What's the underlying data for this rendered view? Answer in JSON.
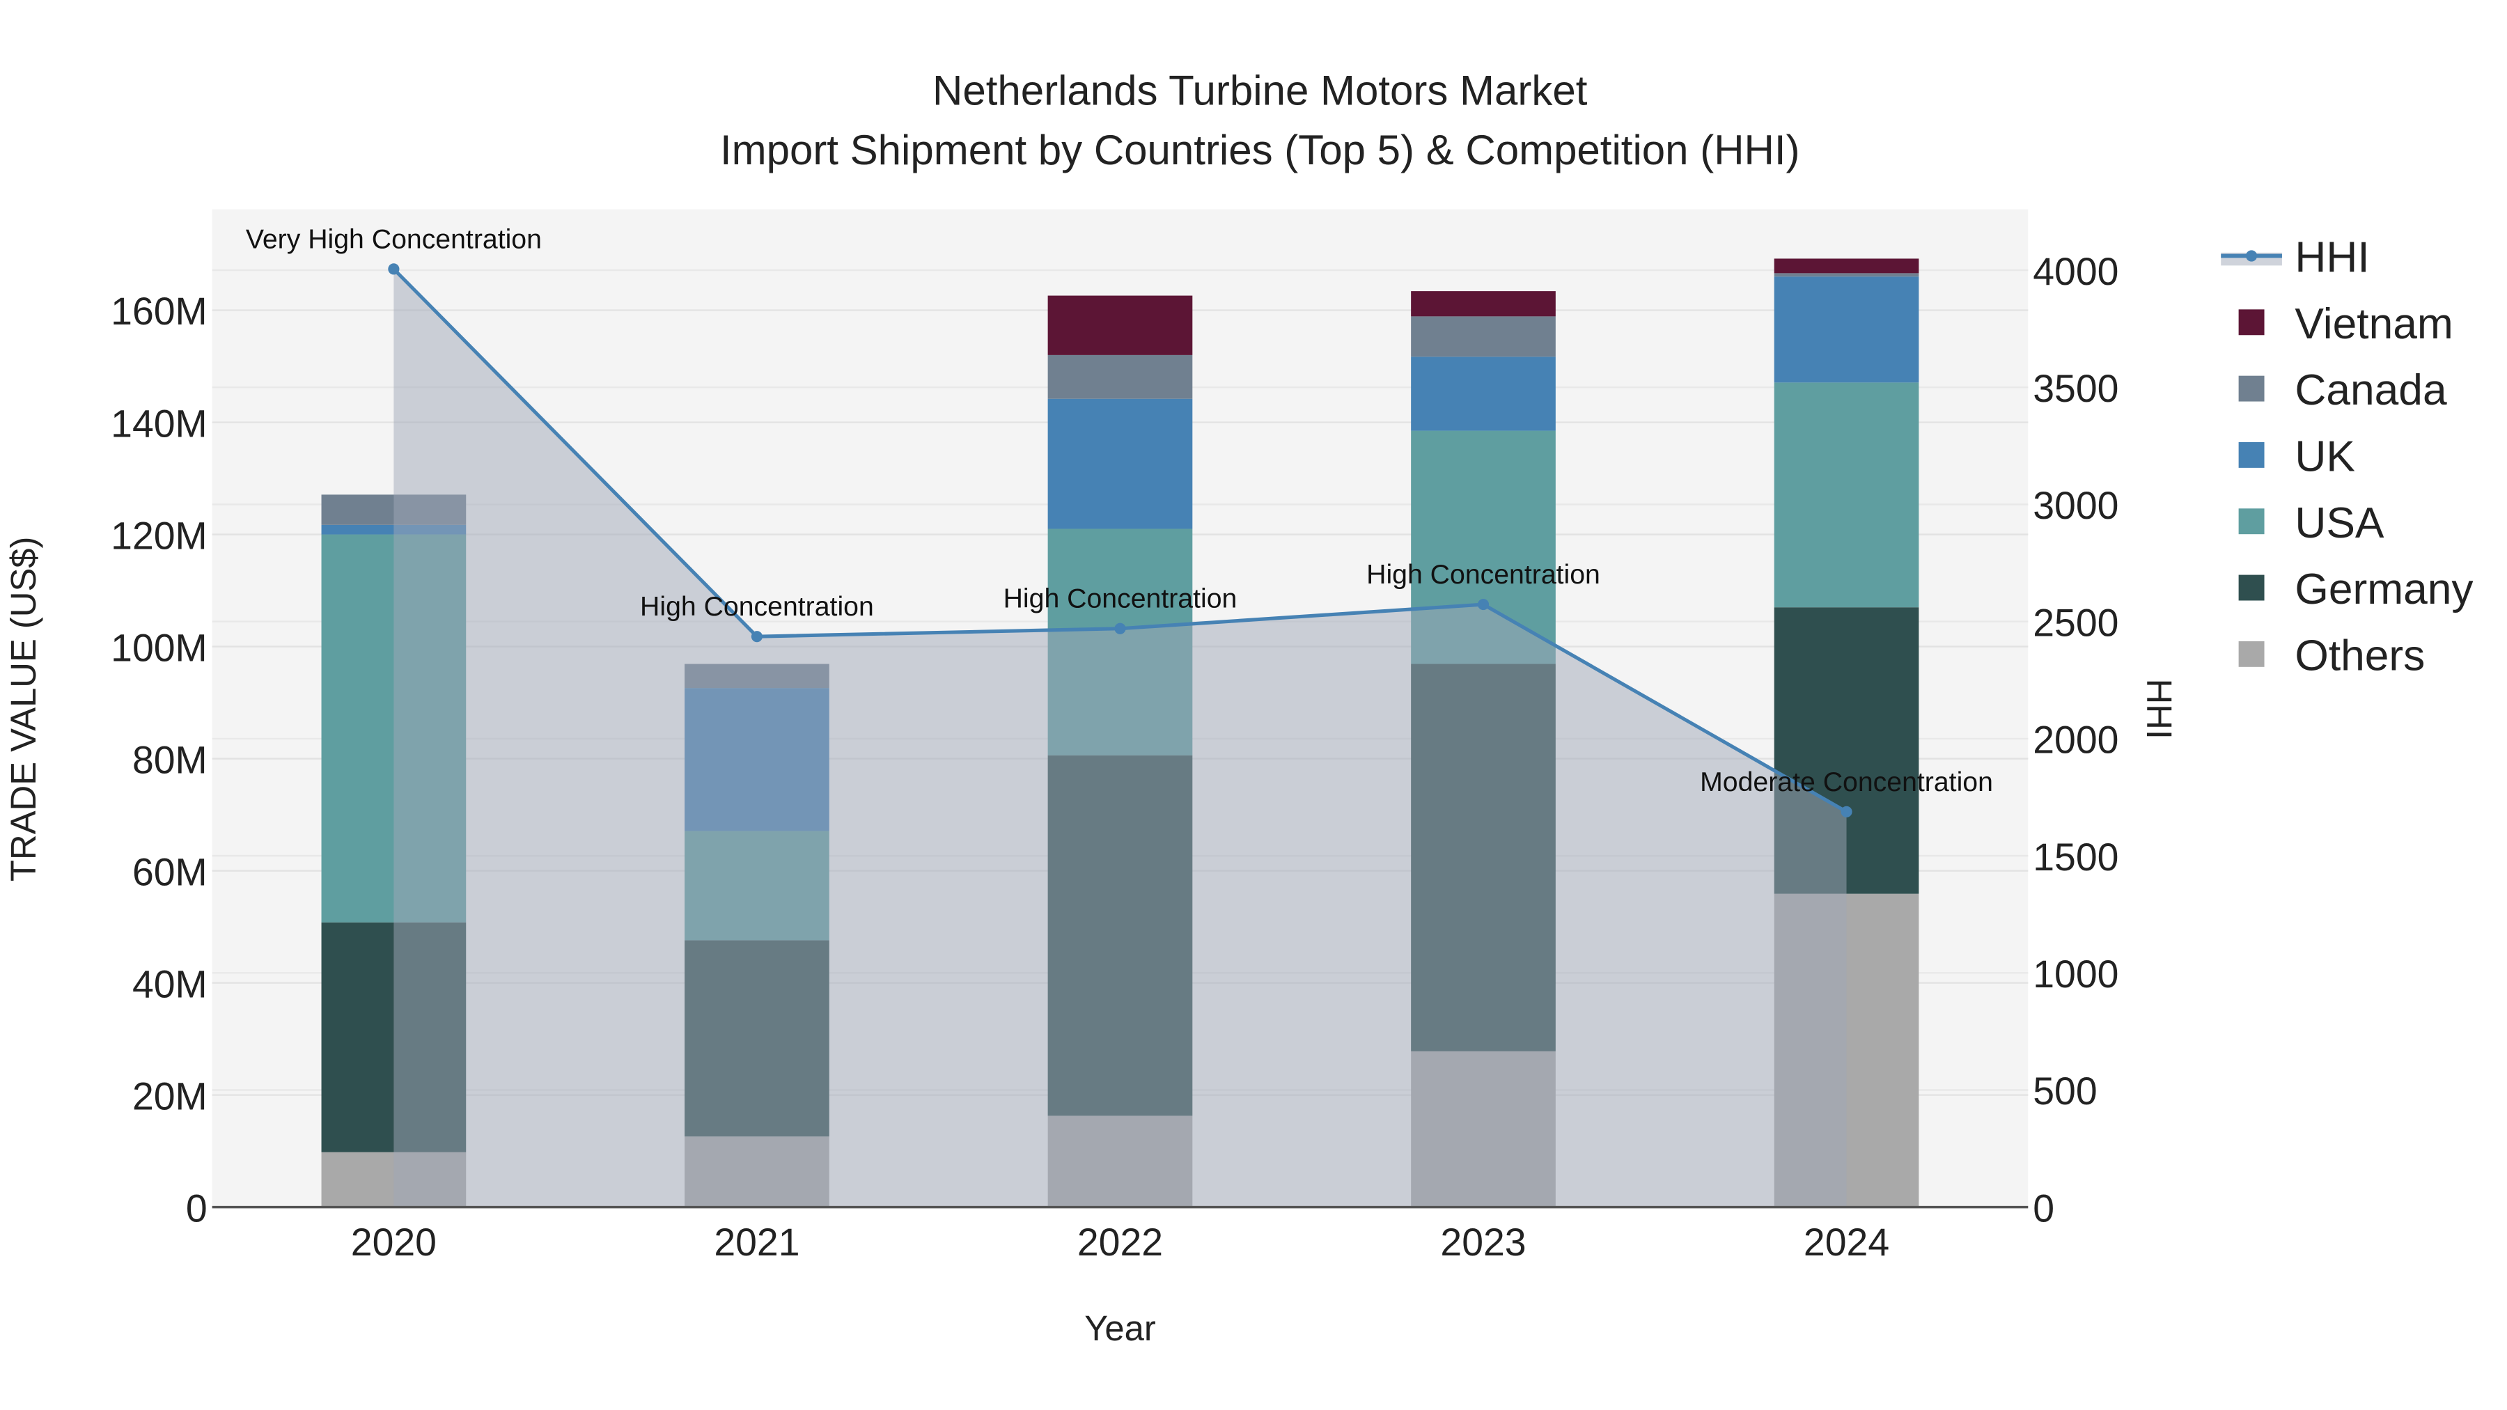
{
  "chart_data": {
    "type": "bar",
    "stacked": true,
    "title": "Netherlands Turbine Motors Market",
    "subtitle": "Import Shipment by Countries (Top 5) & Competition (HHI)",
    "xlabel": "Year",
    "ylabel": "TRADE VALUE (US$)",
    "y2label": "HHI",
    "categories": [
      "2020",
      "2021",
      "2022",
      "2023",
      "2024"
    ],
    "ylim": [
      0,
      178000000
    ],
    "y_ticks": [
      0,
      20000000,
      40000000,
      60000000,
      80000000,
      100000000,
      120000000,
      140000000,
      160000000
    ],
    "y_tick_labels": [
      "0",
      "20M",
      "40M",
      "60M",
      "80M",
      "100M",
      "120M",
      "140M",
      "160M"
    ],
    "y2lim": [
      0,
      4260
    ],
    "y2_ticks": [
      0,
      500,
      1000,
      1500,
      2000,
      2500,
      3000,
      3500,
      4000
    ],
    "y2_tick_labels": [
      "0",
      "500",
      "1000",
      "1500",
      "2000",
      "2500",
      "3000",
      "3500",
      "4000"
    ],
    "grid": true,
    "legend_position": "right",
    "series": [
      {
        "name": "Others",
        "color": "#a9a9a9",
        "values": [
          9800000,
          12600000,
          16300000,
          27800000,
          55900000
        ]
      },
      {
        "name": "Germany",
        "color": "#2f4f4f",
        "values": [
          41000000,
          35000000,
          64300000,
          69100000,
          51100000
        ]
      },
      {
        "name": "USA",
        "color": "#5f9ea0",
        "values": [
          69200000,
          19500000,
          40400000,
          41600000,
          40100000
        ]
      },
      {
        "name": "UK",
        "color": "#4682b4",
        "values": [
          1700000,
          25500000,
          23200000,
          13200000,
          18900000
        ]
      },
      {
        "name": "Canada",
        "color": "#708090",
        "values": [
          5400000,
          4300000,
          7800000,
          7200000,
          600000
        ]
      },
      {
        "name": "Vietnam",
        "color": "#5c1535",
        "values": [
          0,
          0,
          10600000,
          4500000,
          2600000
        ]
      }
    ],
    "line": {
      "name": "HHI",
      "color": "#4682b4",
      "axis": "y2",
      "values": [
        4005,
        2436,
        2470,
        2573,
        1688
      ],
      "annotations": [
        "Very High Concentration",
        "High Concentration",
        "High Concentration",
        "High Concentration",
        "Moderate Concentration"
      ]
    },
    "legend": [
      "HHI",
      "Vietnam",
      "Canada",
      "UK",
      "USA",
      "Germany",
      "Others"
    ]
  }
}
